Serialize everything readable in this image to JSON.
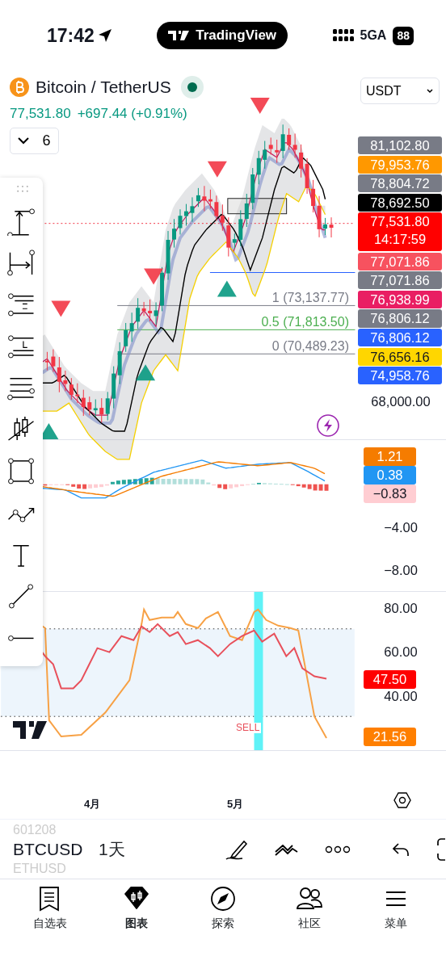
{
  "status_bar": {
    "time": "17:42",
    "app": "TradingView",
    "network": "5GA",
    "battery": "88"
  },
  "symbol": {
    "name": "Bitcoin / TetherUS",
    "live": true,
    "price": "77,531.80",
    "change": "+697.44 (+0.91%)",
    "currency": "USDT",
    "indicator_count": "6"
  },
  "price_scale": [
    {
      "text": "81,102.80",
      "color": "#787b86"
    },
    {
      "text": "79,953.76",
      "color": "#ff9800"
    },
    {
      "text": "78,804.72",
      "color": "#787b86"
    },
    {
      "text": "78,692.50",
      "color": "#000000"
    },
    {
      "text": "77,531.80",
      "sub": "14:17:59",
      "color": "#ff0000"
    },
    {
      "text": "77,071.86",
      "color": "#f7525f"
    },
    {
      "text": "77,071.86",
      "color": "#787b86"
    },
    {
      "text": "76,938.99",
      "color": "#e91e63"
    },
    {
      "text": "76,806.12",
      "color": "#787b86"
    },
    {
      "text": "76,806.12",
      "color": "#2962ff"
    },
    {
      "text": "76,656.16",
      "color": "#ffd600"
    },
    {
      "text": "74,958.76",
      "color": "#2962ff"
    }
  ],
  "price_ticks": [
    "68,000.00"
  ],
  "fib_levels": [
    {
      "text": "1 (73,137.77)",
      "color": "#787b86"
    },
    {
      "text": "0.5 (71,813.50)",
      "color": "#4caf50"
    },
    {
      "text": "0 (70,489.23)",
      "color": "#787b86"
    }
  ],
  "macd_scale": [
    {
      "kind": "tag",
      "text": "1.21",
      "color": "#f57c00"
    },
    {
      "kind": "tag",
      "text": "0.38",
      "color": "#2196f3"
    },
    {
      "kind": "tag",
      "text": "−0.83",
      "color": "#ffcdd2"
    },
    {
      "kind": "tick",
      "text": "−4.00"
    },
    {
      "kind": "tick",
      "text": "−8.00"
    }
  ],
  "rsi_scale": [
    {
      "kind": "tick",
      "text": "80.00"
    },
    {
      "kind": "tick",
      "text": "60.00"
    },
    {
      "kind": "tag",
      "text": "47.50",
      "color": "#ff0000"
    },
    {
      "kind": "tick",
      "text": "40.00"
    },
    {
      "kind": "tag",
      "text": "21.56",
      "color": "#ff7f00"
    }
  ],
  "signal_label": "SELL",
  "time_axis": [
    "4月",
    "5月"
  ],
  "toolbar": {
    "symbols": [
      {
        "text": "601208",
        "selected": false
      },
      {
        "text": "BTCUSD",
        "selected": true
      },
      {
        "text": "ETHUSD",
        "selected": false
      }
    ],
    "interval": "1天"
  },
  "nav": [
    {
      "label": "自选表",
      "selected": false
    },
    {
      "label": "图表",
      "selected": true
    },
    {
      "label": "探索",
      "selected": false
    },
    {
      "label": "社区",
      "selected": false
    },
    {
      "label": "菜单",
      "selected": false
    }
  ]
}
